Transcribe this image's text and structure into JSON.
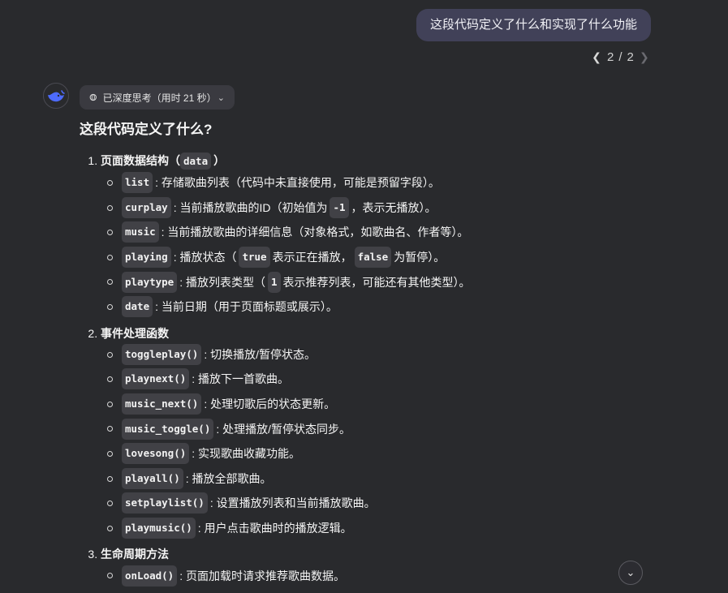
{
  "user_message": "这段代码定义了什么和实现了什么功能",
  "pager": {
    "current": "2",
    "sep": "/",
    "total": "2"
  },
  "think": {
    "label": "已深度思考（用时 21 秒）"
  },
  "answer": {
    "heading": "这段代码定义了什么?",
    "sections": [
      {
        "num": "1.",
        "title_prefix": "页面数据结构（",
        "title_code": "data",
        "title_suffix": "）",
        "items": [
          {
            "code": "list",
            "text": ": 存储歌曲列表（代码中未直接使用，可能是预留字段）。"
          },
          {
            "code": "curplay",
            "text_a": ": 当前播放歌曲的ID（初始值为",
            "code2": "-1",
            "text_b": "，表示无播放）。"
          },
          {
            "code": "music",
            "text": ": 当前播放歌曲的详细信息（对象格式，如歌曲名、作者等）。"
          },
          {
            "code": "playing",
            "text_a": ": 播放状态（",
            "code2": "true",
            "text_b": "表示正在播放，",
            "code3": "false",
            "text_c": "为暂停）。"
          },
          {
            "code": "playtype",
            "text_a": ": 播放列表类型（",
            "code2": "1",
            "text_b": "表示推荐列表，可能还有其他类型）。"
          },
          {
            "code": "date",
            "text": ": 当前日期（用于页面标题或展示）。"
          }
        ]
      },
      {
        "num": "2.",
        "title": "事件处理函数",
        "items": [
          {
            "code": "toggleplay()",
            "text": ": 切换播放/暂停状态。"
          },
          {
            "code": "playnext()",
            "text": ": 播放下一首歌曲。"
          },
          {
            "code": "music_next()",
            "text": ": 处理切歌后的状态更新。"
          },
          {
            "code": "music_toggle()",
            "text": ": 处理播放/暂停状态同步。"
          },
          {
            "code": "lovesong()",
            "text": ": 实现歌曲收藏功能。"
          },
          {
            "code": "playall()",
            "text": ": 播放全部歌曲。"
          },
          {
            "code": "setplaylist()",
            "text": ": 设置播放列表和当前播放歌曲。"
          },
          {
            "code": "playmusic()",
            "text": ": 用户点击歌曲时的播放逻辑。"
          }
        ]
      },
      {
        "num": "3.",
        "title": "生命周期方法",
        "items": [
          {
            "code": "onLoad()",
            "text": ": 页面加载时请求推荐歌曲数据。"
          }
        ]
      }
    ]
  },
  "icons": {
    "avatar": "whale-logo-icon",
    "think": "deep-think-icon",
    "collapse": "chevron-down-icon",
    "prev": "chevron-left-icon",
    "next": "chevron-right-icon",
    "scroll": "arrow-down-icon"
  },
  "colors": {
    "background": "#292a2d",
    "bubble": "#414158",
    "brand": "#4d6bfe"
  }
}
